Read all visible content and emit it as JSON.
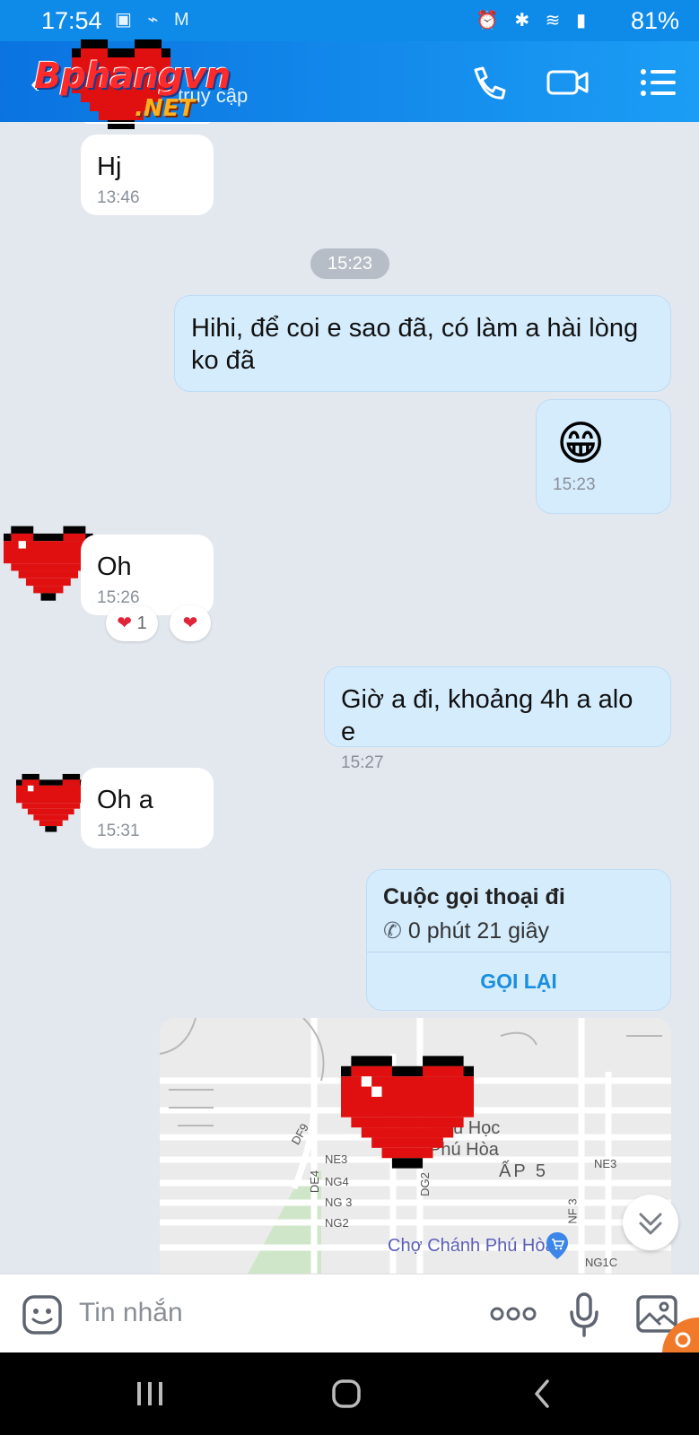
{
  "status_bar": {
    "time": "17:54",
    "battery": "81%"
  },
  "header": {
    "logo_main": "Bphangvn",
    "logo_sub": ".NET",
    "subtitle": "truy cập",
    "back_glyph": "‹"
  },
  "messages": [
    {
      "text": "Hj",
      "time": "13:46"
    },
    {
      "divider": "15:23"
    },
    {
      "text": "Hihi, để coi e sao đã, có làm a hài lòng ko đã"
    },
    {
      "emoji": "😁",
      "time": "15:23"
    },
    {
      "text": "Oh",
      "time": "15:26",
      "reactions": {
        "heart_count": "1"
      }
    },
    {
      "text": "Giờ a đi, khoảng 4h a alo e",
      "time": "15:27"
    },
    {
      "text": "Oh a",
      "time": "15:31"
    }
  ],
  "call": {
    "title": "Cuộc gọi thoại đi",
    "duration": "0 phút 21 giây",
    "callback_label": "GỌI LẠI"
  },
  "map": {
    "labels": [
      "Tiểu Học",
      "Phú Hòa",
      "ẤP 5",
      "NE3",
      "NE3",
      "NG4",
      "NG 3",
      "NG2",
      "DE4",
      "DG2",
      "NF 3",
      "DF9",
      "NG1C"
    ],
    "market": "Chợ Chánh Phú Hòa"
  },
  "input": {
    "placeholder": "Tin nhắn"
  },
  "colors": {
    "header": "#0e8ae8",
    "outgoing_bubble": "#d5ecfd",
    "incoming_bubble": "#ffffff",
    "background": "#e3e8ef",
    "accent": "#1a8ee2"
  }
}
